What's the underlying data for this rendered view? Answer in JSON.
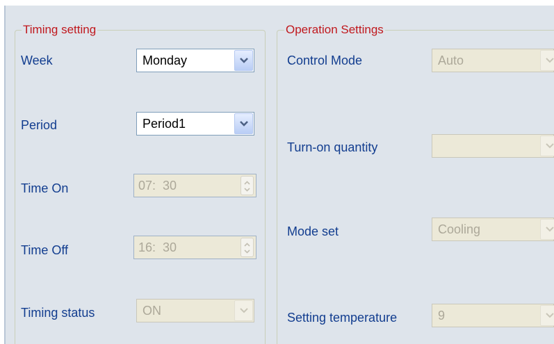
{
  "timing_setting": {
    "title": "Timing setting",
    "week": {
      "label": "Week",
      "value": "Monday"
    },
    "period": {
      "label": "Period",
      "value": "Period1"
    },
    "time_on": {
      "label": "Time On",
      "value": "07:  30"
    },
    "time_off": {
      "label": "Time Off",
      "value": "16:  30"
    },
    "timing_status": {
      "label": "Timing status",
      "value": "ON"
    }
  },
  "operation_settings": {
    "title": "Operation Settings",
    "control_mode": {
      "label": "Control Mode",
      "value": "Auto"
    },
    "turn_on_quantity": {
      "label": "Turn-on quantity",
      "value": ""
    },
    "mode_set": {
      "label": "Mode set",
      "value": "Cooling"
    },
    "setting_temperature": {
      "label": "Setting temperature",
      "value": "9"
    }
  },
  "icons": {
    "dropdown": "chevron-down-icon",
    "spinner": "spinner-arrows-icon"
  },
  "colors": {
    "background": "#dee4eb",
    "group_title": "#c0181d",
    "label": "#123d8f"
  }
}
